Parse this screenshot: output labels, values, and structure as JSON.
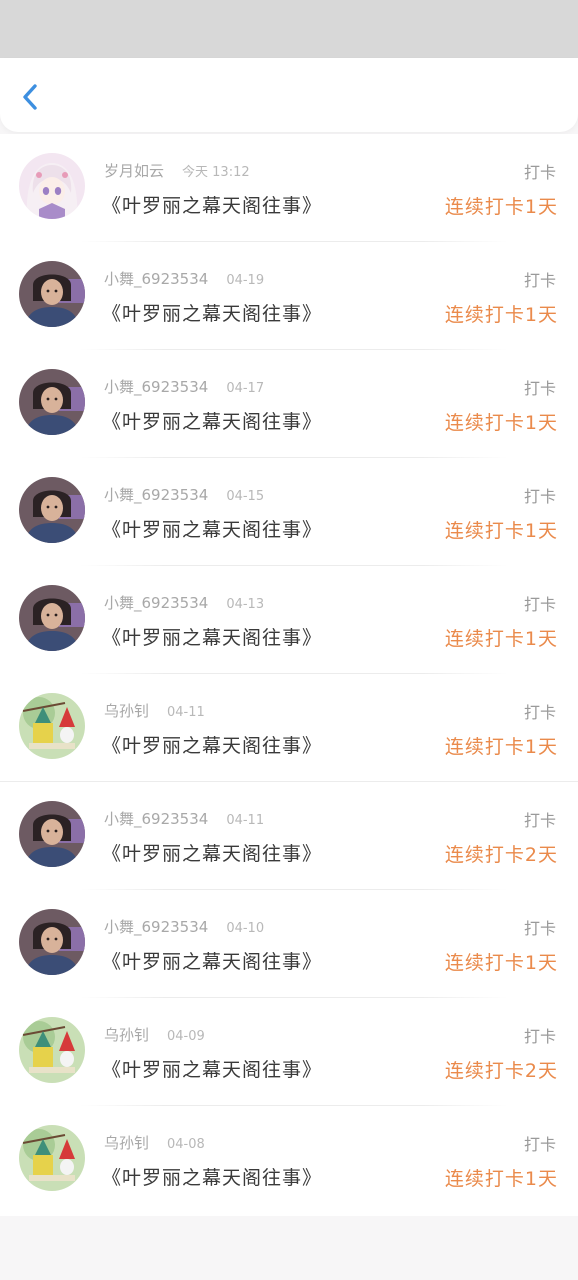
{
  "header": {
    "back_label": "‹"
  },
  "entries": [
    {
      "user": "岁月如云",
      "time": "今天 13:12",
      "title": "《叶罗丽之幕天阁往事》",
      "tag": "打卡",
      "streak": "连续打卡1天",
      "avatar": "anime-girl"
    },
    {
      "user": "小舞_6923534",
      "time": "04-19",
      "title": "《叶罗丽之幕天阁往事》",
      "tag": "打卡",
      "streak": "连续打卡1天",
      "avatar": "girl-photo"
    },
    {
      "user": "小舞_6923534",
      "time": "04-17",
      "title": "《叶罗丽之幕天阁往事》",
      "tag": "打卡",
      "streak": "连续打卡1天",
      "avatar": "girl-photo"
    },
    {
      "user": "小舞_6923534",
      "time": "04-15",
      "title": "《叶罗丽之幕天阁往事》",
      "tag": "打卡",
      "streak": "连续打卡1天",
      "avatar": "girl-photo"
    },
    {
      "user": "小舞_6923534",
      "time": "04-13",
      "title": "《叶罗丽之幕天阁往事》",
      "tag": "打卡",
      "streak": "连续打卡1天",
      "avatar": "girl-photo"
    },
    {
      "user": "乌孙钊",
      "time": "04-11",
      "title": "《叶罗丽之幕天阁往事》",
      "tag": "打卡",
      "streak": "连续打卡1天",
      "avatar": "gnome-toy"
    },
    {
      "user": "小舞_6923534",
      "time": "04-11",
      "title": "《叶罗丽之幕天阁往事》",
      "tag": "打卡",
      "streak": "连续打卡2天",
      "avatar": "girl-photo"
    },
    {
      "user": "小舞_6923534",
      "time": "04-10",
      "title": "《叶罗丽之幕天阁往事》",
      "tag": "打卡",
      "streak": "连续打卡1天",
      "avatar": "girl-photo"
    },
    {
      "user": "乌孙钊",
      "time": "04-09",
      "title": "《叶罗丽之幕天阁往事》",
      "tag": "打卡",
      "streak": "连续打卡2天",
      "avatar": "gnome-toy"
    },
    {
      "user": "乌孙钊",
      "time": "04-08",
      "title": "《叶罗丽之幕天阁往事》",
      "tag": "打卡",
      "streak": "连续打卡1天",
      "avatar": "gnome-toy"
    }
  ],
  "colors": {
    "accent_blue": "#3d8fe0",
    "streak_orange": "#ea8a4b",
    "status_bar_gray": "#d8d8d8"
  }
}
